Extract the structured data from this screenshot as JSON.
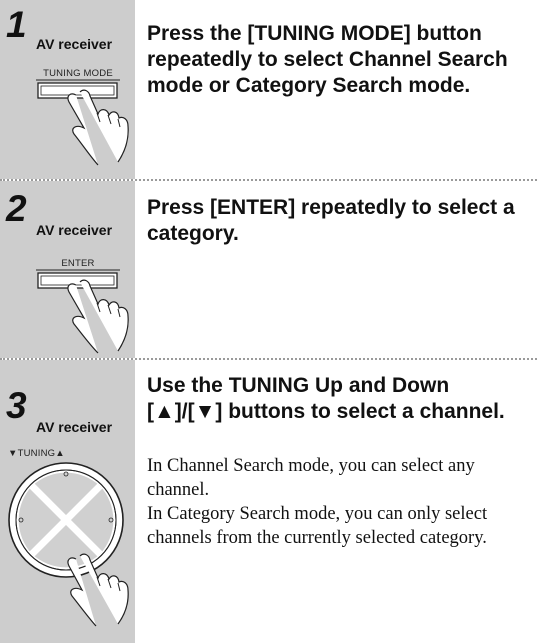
{
  "steps": [
    {
      "number": "1",
      "device": "AV receiver",
      "button_label": "TUNING MODE",
      "title": "Press the [TUNING MODE] button repeatedly to select Channel Search mode or Category Search mode."
    },
    {
      "number": "2",
      "device": "AV receiver",
      "button_label": "ENTER",
      "title": "Press [ENTER] repeatedly to select a category."
    },
    {
      "number": "3",
      "device": "AV receiver",
      "button_label": "▼TUNING▲",
      "title": "Use the TUNING Up and Down [▲]/[▼] buttons to select a channel.",
      "paragraphs": [
        "In Channel Search mode, you can select any channel.",
        "In Category Search mode, you can only select channels from the currently selected category."
      ]
    }
  ],
  "icons": [
    "hand-pointer-icon",
    "button-icon",
    "tuning-dial-icon"
  ]
}
